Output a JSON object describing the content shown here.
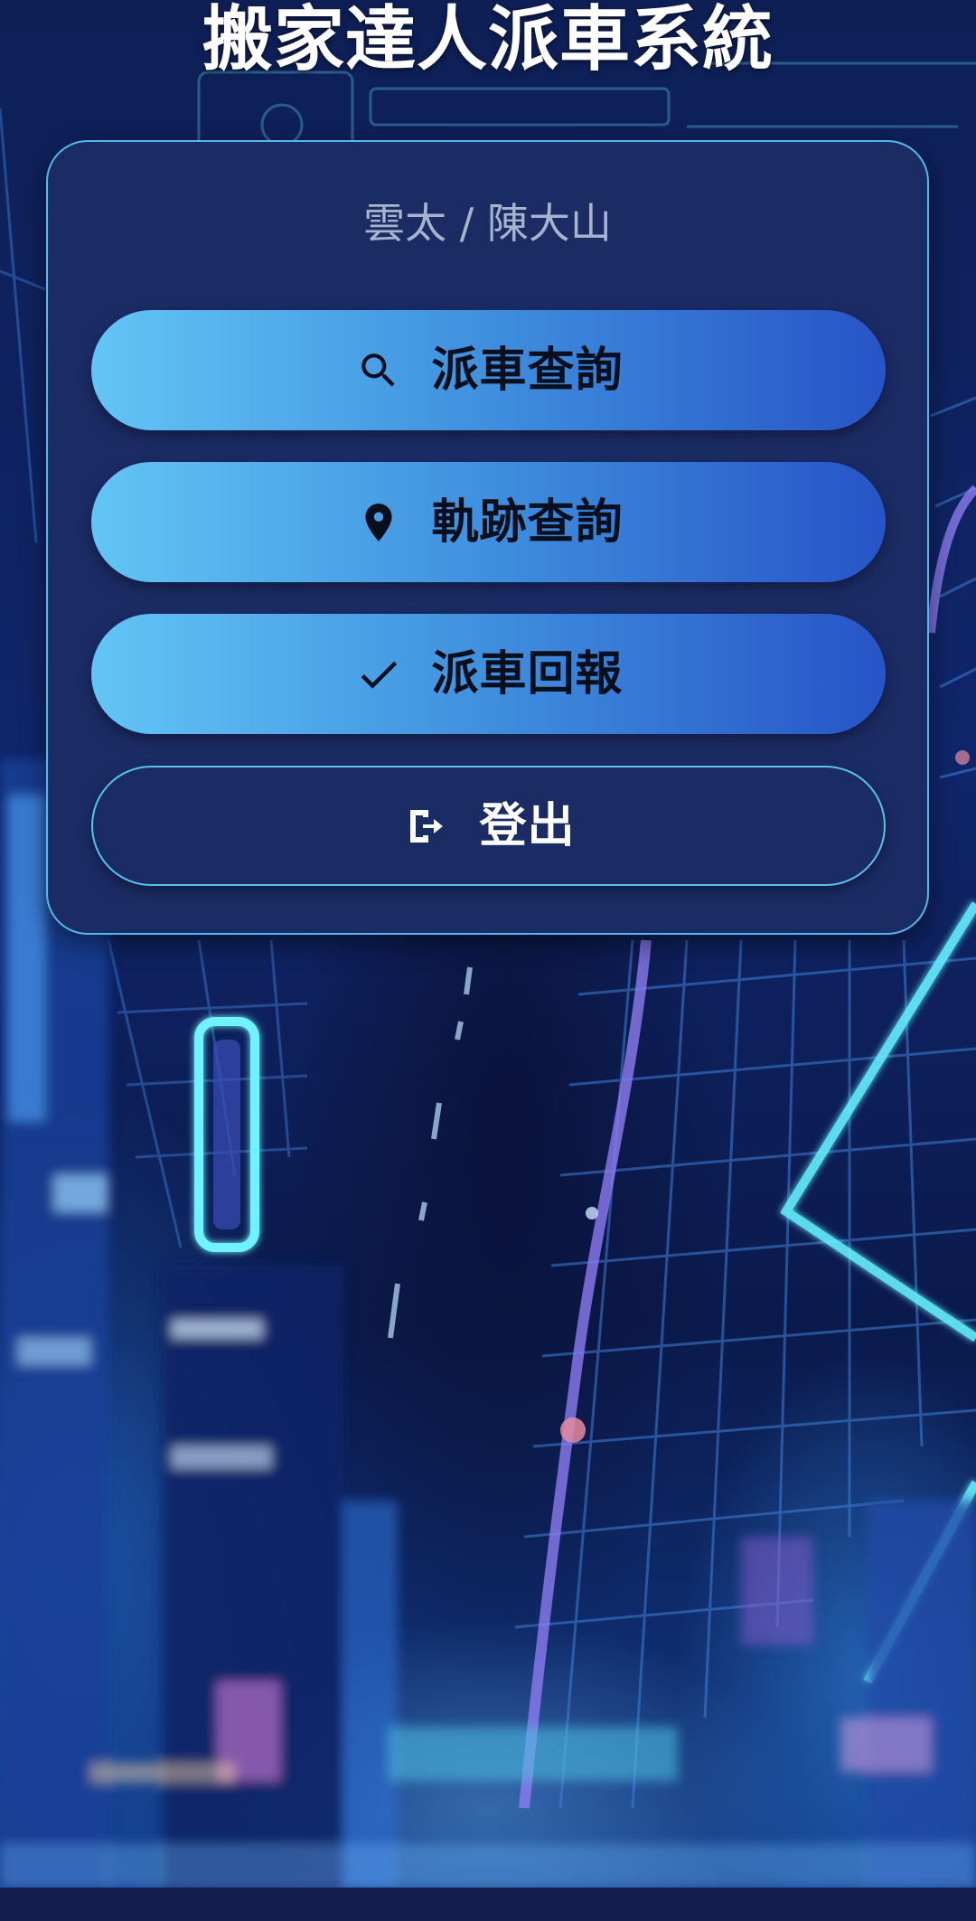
{
  "app": {
    "title": "搬家達人派車系統"
  },
  "user": {
    "identity": "雲太 / 陳大山"
  },
  "menu": {
    "items": [
      {
        "label": "派車查詢",
        "icon": "search-icon",
        "style": "primary"
      },
      {
        "label": "軌跡查詢",
        "icon": "location-pin-icon",
        "style": "primary"
      },
      {
        "label": "派車回報",
        "icon": "checkmark-icon",
        "style": "primary"
      },
      {
        "label": "登出",
        "icon": "logout-icon",
        "style": "outline"
      }
    ]
  },
  "colors": {
    "card_background": "#1b2b64",
    "card_border": "#53b8ec",
    "button_gradient_start": "#63c5f5",
    "button_gradient_end": "#2754c7",
    "page_background": "#0d1a46"
  }
}
